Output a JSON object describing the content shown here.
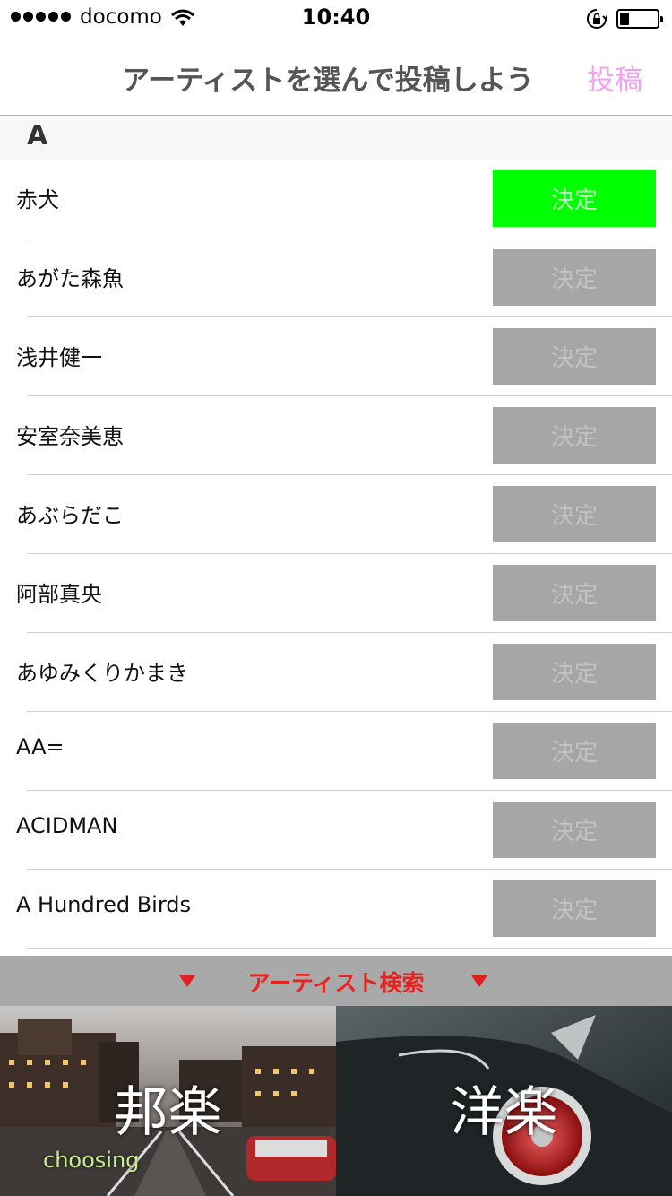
{
  "status_bar": {
    "carrier": "docomo",
    "time": "10:40",
    "battery_level": 0.25
  },
  "nav": {
    "title": "アーティストを選んで投稿しよう",
    "post_label": "投稿"
  },
  "section": {
    "letter": "A"
  },
  "decide_label": "決定",
  "artists": [
    {
      "name": "赤犬",
      "selected": true
    },
    {
      "name": "あがた森魚",
      "selected": false
    },
    {
      "name": "浅井健一",
      "selected": false
    },
    {
      "name": "安室奈美恵",
      "selected": false
    },
    {
      "name": "あぶらだこ",
      "selected": false
    },
    {
      "name": "阿部真央",
      "selected": false
    },
    {
      "name": "あゆみくりかまき",
      "selected": false
    },
    {
      "name": "AA=",
      "selected": false
    },
    {
      "name": "ACIDMAN",
      "selected": false
    },
    {
      "name": "A Hundred Birds",
      "selected": false
    }
  ],
  "search": {
    "label": "アーティスト検索"
  },
  "genres": {
    "japanese": {
      "label": "邦楽",
      "status": "choosing"
    },
    "western": {
      "label": "洋楽"
    }
  },
  "colors": {
    "selected_button": "#00ff00",
    "unselected_button": "#a6a6a6",
    "post_accent": "#f0a3f0",
    "search_text": "#e8231f",
    "choosing_text": "#c9f08d"
  }
}
